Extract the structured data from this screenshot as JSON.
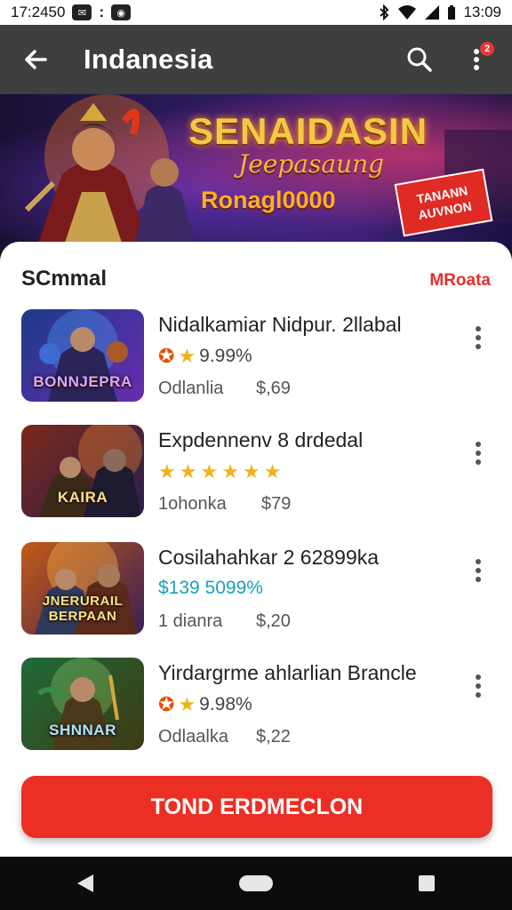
{
  "status_bar": {
    "time_left": "17:2450",
    "time_right": "13:09",
    "left_icons": [
      "messenger-icon",
      "more-dots-icon",
      "app-icon"
    ],
    "right_icons": [
      "bluetooth-icon",
      "wifi-icon",
      "signal-icon",
      "battery-icon"
    ]
  },
  "app_bar": {
    "title": "Indanesia",
    "notification_count": "2",
    "icons": [
      "back-arrow-icon",
      "search-icon",
      "overflow-menu-icon"
    ]
  },
  "banner": {
    "headline": "SENAIDASIN",
    "subheadline": "Jeepasaung",
    "promo": "Ronagl0000",
    "badge_line1": "TANANN",
    "badge_line2": "AUVNON"
  },
  "section": {
    "title": "SCmmal",
    "link": "MRoata"
  },
  "items": [
    {
      "title": "Nidalkamiar Nidpur. 2llabal",
      "thumb_label": "BONNJEPRA",
      "rating_text": "9.99%",
      "rating_style": "one-star",
      "meta": "Odlanlia",
      "price": "$,69",
      "colors": [
        "#1c3a8a",
        "#6a2cae"
      ]
    },
    {
      "title": "Expdennenv 8 drdedal",
      "thumb_label": "KAIRA",
      "rating_text": "",
      "rating_style": "five-stars",
      "meta": "1ohonka",
      "price": "$79",
      "colors": [
        "#7a2a1a",
        "#2a1e4e"
      ]
    },
    {
      "title": "Cosilahahkar 2 62899ka",
      "thumb_label": "JNERURAIL BERPAAN",
      "rating_text": "$139 5099%",
      "rating_style": "teal",
      "meta": "1 dianra",
      "price": "$,20",
      "colors": [
        "#c25a16",
        "#3b1f56"
      ]
    },
    {
      "title": "Yirdargrme ahlarlian Brancle",
      "thumb_label": "SHNNAR",
      "rating_text": "9.98%",
      "rating_style": "one-star",
      "meta": "Odlaalka",
      "price": "$,22",
      "colors": [
        "#1e6b3a",
        "#3e3a12"
      ]
    }
  ],
  "cta": {
    "label": "TOND ERDMECLON"
  },
  "nav_bar": {
    "icons": [
      "back-triangle-icon",
      "home-pill-icon",
      "recents-square-icon"
    ]
  },
  "colors": {
    "accent": "#ec2f25",
    "app_bar": "#3d403f",
    "star": "#f2b21c",
    "teal": "#1aa0b8"
  }
}
